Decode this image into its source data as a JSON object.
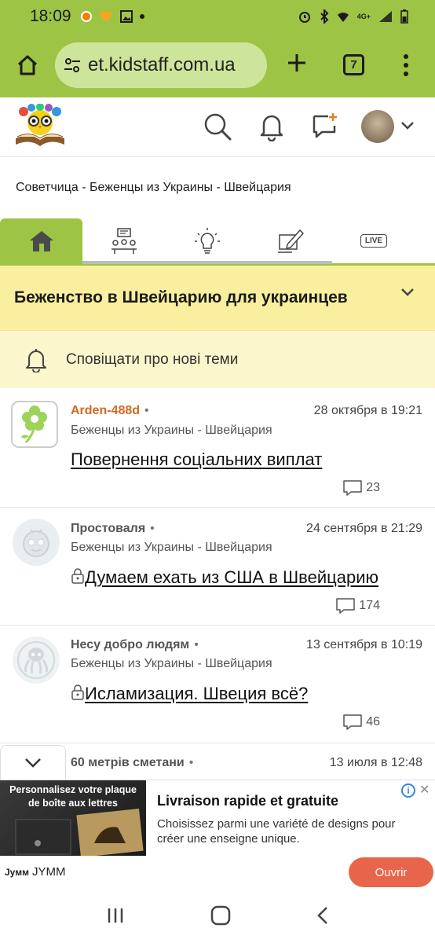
{
  "status": {
    "time": "18:09",
    "network_label": "4G+"
  },
  "browser": {
    "url": "et.kidstaff.com.ua",
    "tab_count": "7"
  },
  "breadcrumb": "Советчица - Беженцы из Украины - Швейцария",
  "nav_tabs": [
    "home",
    "community",
    "ideas",
    "write",
    "live"
  ],
  "live_label": "LIVE",
  "topic": {
    "title": "Беженство в Швейцарию для украинцев",
    "notify_label": "Сповіщати про нові теми"
  },
  "posts": [
    {
      "author": "Arden-488d",
      "date": "28 октября в 19:21",
      "category": "Беженцы из Украины - Швейцария",
      "title": "Повернення соціальних виплат",
      "comments": "23",
      "locked": false
    },
    {
      "author": "Простоваля",
      "date": "24 сентября в 21:29",
      "category": "Беженцы из Украины - Швейцария",
      "title": "Думаем ехать из США в Швейцарию",
      "comments": "174",
      "locked": true
    },
    {
      "author": "Несу добро людям",
      "date": "13 сентября в 10:19",
      "category": "Беженцы из Украины - Швейцария",
      "title": "Исламизация. Швеция всё?",
      "comments": "46",
      "locked": true
    },
    {
      "author": "60 метрів сметани",
      "date": "13 июля в 12:48"
    }
  ],
  "ad": {
    "image_caption": "Personnalisez votre plaque de boîte aux lettres",
    "title": "Livraison rapide et gratuite",
    "text": "Choisissez parmi une variété de designs pour créer une enseigne unique.",
    "brand_logo": "Jумм",
    "brand": "JYMM",
    "button": "Ouvrir"
  },
  "colors": {
    "brand_green": "#9dc444",
    "topic_yellow": "#f9ef9e",
    "notify_yellow": "#fcf6cc",
    "author_orange": "#d2691e",
    "ad_button": "#e8654b"
  }
}
